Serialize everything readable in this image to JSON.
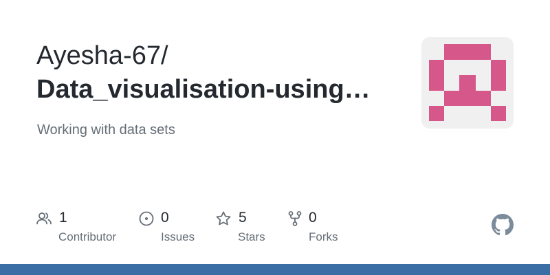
{
  "repo": {
    "owner": "Ayesha-67/",
    "name": "Data_visualisation-using…",
    "description": "Working with data sets"
  },
  "stats": {
    "contributors": {
      "count": "1",
      "label": "Contributor",
      "icon": "people-icon"
    },
    "issues": {
      "count": "0",
      "label": "Issues",
      "icon": "issue-opened-icon"
    },
    "stars": {
      "count": "5",
      "label": "Stars",
      "icon": "star-icon"
    },
    "forks": {
      "count": "0",
      "label": "Forks",
      "icon": "repo-forked-icon"
    }
  },
  "brand": {
    "logo": "github-mark-icon",
    "avatar": "identicon"
  },
  "colors": {
    "identicon": "#d6588a",
    "avatar_bg": "#f0f0f0",
    "icon": "#656d76",
    "logo": "#7c8b9a",
    "bottom_bar": "#3a6ea5"
  }
}
